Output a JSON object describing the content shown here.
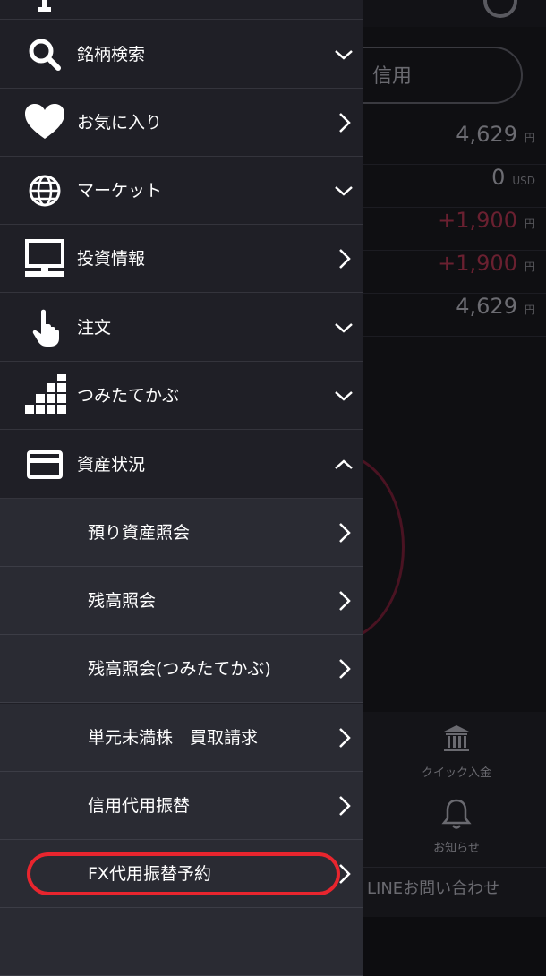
{
  "background": {
    "credit_button_label": "信用",
    "rows": [
      {
        "value": "4,629",
        "unit": "円",
        "negative": false
      },
      {
        "value": "0",
        "unit": "USD",
        "negative": false
      },
      {
        "value": "+1,900",
        "unit": "円",
        "negative": true
      },
      {
        "value": "+1,900",
        "unit": "円",
        "negative": true
      },
      {
        "value": "4,629",
        "unit": "円",
        "negative": false
      }
    ],
    "quick_deposit_label": "クイック入金",
    "notice_label": "お知らせ",
    "line_contact_label": "LINEお問い合わせ"
  },
  "menu": {
    "items": [
      {
        "label": "銘柄検索",
        "icon": "search-icon",
        "chevron": "down"
      },
      {
        "label": "お気に入り",
        "icon": "heart-icon",
        "chevron": "right"
      },
      {
        "label": "マーケット",
        "icon": "globe-icon",
        "chevron": "down"
      },
      {
        "label": "投資情報",
        "icon": "monitor-icon",
        "chevron": "right"
      },
      {
        "label": "注文",
        "icon": "hand-pointer-icon",
        "chevron": "down"
      },
      {
        "label": "つみたてかぶ",
        "icon": "blocks-chart-icon",
        "chevron": "down"
      },
      {
        "label": "資産状況",
        "icon": "card-icon",
        "chevron": "up"
      }
    ],
    "sub_items": [
      {
        "label": "預り資産照会"
      },
      {
        "label": "残高照会"
      },
      {
        "label": "残高照会(つみたてかぶ)"
      },
      {
        "label": "単元未満株　買取請求"
      },
      {
        "label": "信用代用振替"
      },
      {
        "label": "FX代用振替予約"
      }
    ]
  },
  "colors": {
    "menu_bg": "#1f1f26",
    "submenu_bg": "#2a2b33",
    "highlight": "#e8252e",
    "negative_value": "#6a2030"
  }
}
